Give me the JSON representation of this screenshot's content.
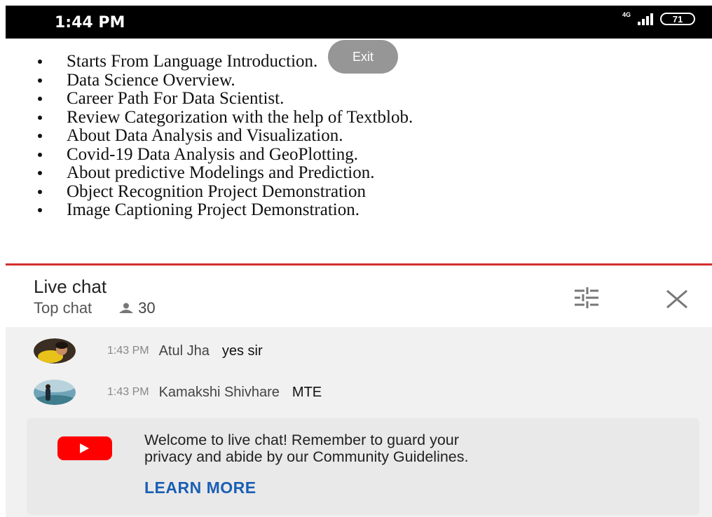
{
  "status_bar": {
    "time": "1:44 PM",
    "network": "4G",
    "battery": "71"
  },
  "video": {
    "exit_label": "Exit",
    "slide_items": [
      "Starts From Language Introduction.",
      "Data Science Overview.",
      "Career Path For Data Scientist.",
      "Review Categorization with the help of Textblob.",
      "About Data Analysis and Visualization.",
      "Covid-19 Data Analysis and GeoPlotting.",
      "About predictive Modelings and Prediction.",
      "Object Recognition Project Demonstration",
      "Image Captioning Project Demonstration."
    ]
  },
  "chat_header": {
    "title": "Live chat",
    "mode": "Top chat",
    "viewer_count": "30",
    "icons": [
      "filter-icon",
      "close-icon",
      "person-icon"
    ]
  },
  "messages": [
    {
      "time": "1:43 PM",
      "author": "Atul Jha",
      "text": "yes sir"
    },
    {
      "time": "1:43 PM",
      "author": "Kamakshi Shivhare",
      "text": "MTE"
    }
  ],
  "welcome": {
    "text_line1": "Welcome to live chat! Remember to guard your",
    "text_line2": "privacy and abide by our Community Guidelines.",
    "learn_more": "LEARN MORE"
  },
  "colors": {
    "accent_red": "#d32f2f",
    "link_blue": "#1a5fb4",
    "youtube_red": "#ff0000"
  }
}
